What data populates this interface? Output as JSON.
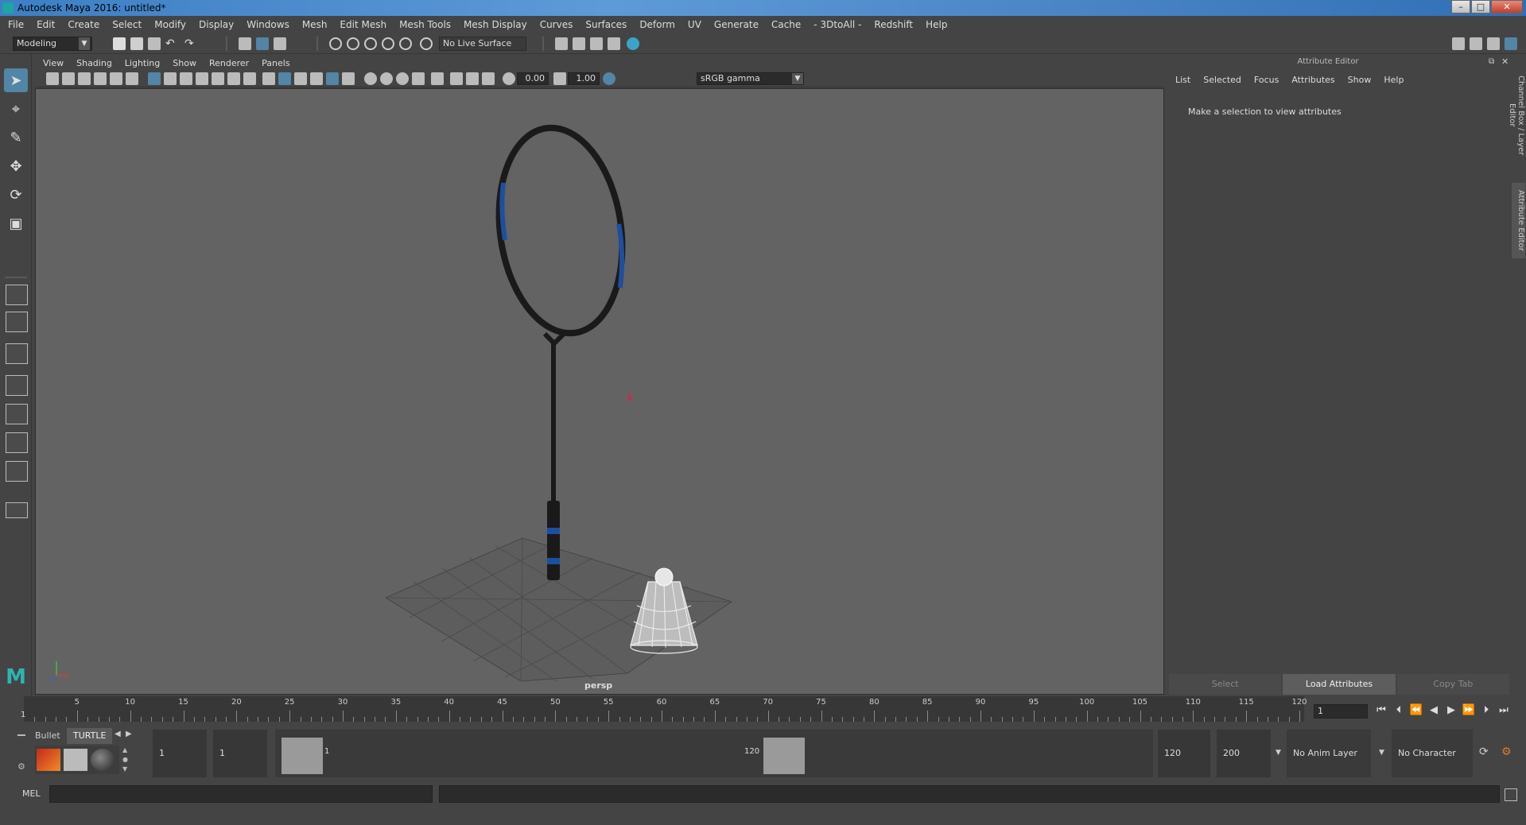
{
  "window": {
    "title": "Autodesk Maya 2016: untitled*",
    "min": "–",
    "max": "□",
    "close": "✕"
  },
  "menubar": [
    "File",
    "Edit",
    "Create",
    "Select",
    "Modify",
    "Display",
    "Windows",
    "Mesh",
    "Edit Mesh",
    "Mesh Tools",
    "Mesh Display",
    "Curves",
    "Surfaces",
    "Deform",
    "UV",
    "Generate",
    "Cache",
    "- 3DtoAll -",
    "Redshift",
    "Help"
  ],
  "statusline": {
    "mode": "Modeling",
    "live_surface": "No Live Surface"
  },
  "panel": {
    "menus": [
      "View",
      "Shading",
      "Lighting",
      "Show",
      "Renderer",
      "Panels"
    ],
    "exposure": "0.00",
    "gamma": "1.00",
    "color_space": "sRGB gamma",
    "camera": "persp"
  },
  "attribute_editor": {
    "title": "Attribute Editor",
    "menus": [
      "List",
      "Selected",
      "Focus",
      "Attributes",
      "Show",
      "Help"
    ],
    "hint": "Make a selection to view attributes",
    "buttons": [
      "Select",
      "Load Attributes",
      "Copy Tab"
    ],
    "side_tabs": [
      "Channel Box / Layer Editor",
      "Attribute Editor"
    ]
  },
  "timeline": {
    "ticks": [
      5,
      10,
      15,
      20,
      25,
      30,
      35,
      40,
      45,
      50,
      55,
      60,
      65,
      70,
      75,
      80,
      85,
      90,
      95,
      100,
      105,
      110,
      115,
      120
    ],
    "start_label": "1",
    "current_frame": "1"
  },
  "range": {
    "shelf_tabs": [
      "Bullet",
      "TURTLE"
    ],
    "start": "1",
    "playback_start": "1",
    "thumb_start": "1",
    "thumb_end": "120",
    "playback_end": "120",
    "end": "200",
    "anim_layer": "No Anim Layer",
    "character_set": "No Character Set"
  },
  "cmdline": {
    "label": "MEL"
  },
  "colors": {
    "accent": "#5285a6",
    "viewport_bg": "#636363",
    "racket_blue": "#1d4fa0"
  }
}
